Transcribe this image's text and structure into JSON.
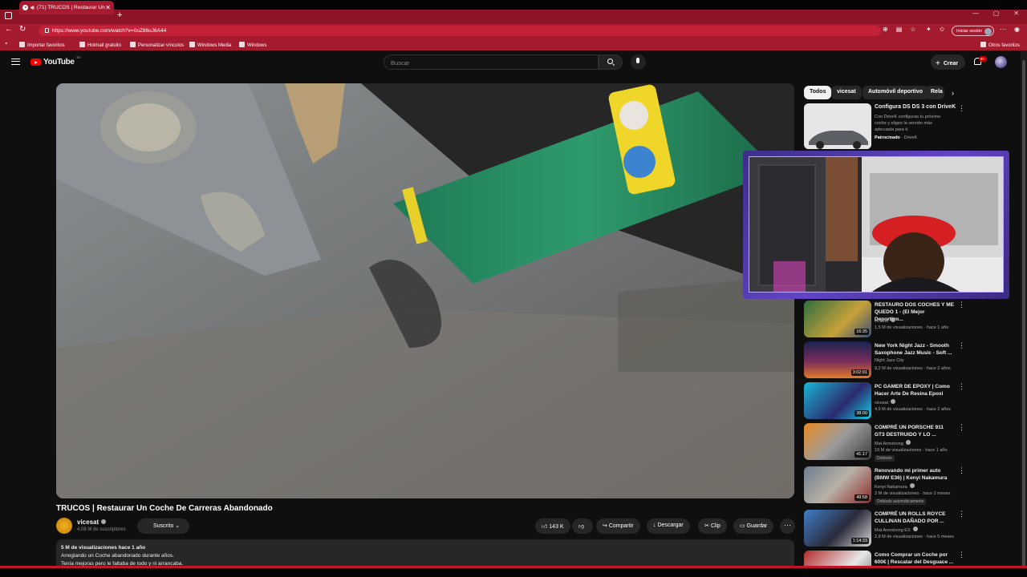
{
  "browser": {
    "tab_title": "(71) TRUCOS | Restaurar Un",
    "url": "https://www.youtube.com/watch?v=0oZ86uJ6A44",
    "sign_in": "Iniciar sesión",
    "favorites": [
      "Importar favoritos",
      "Hotmail gratuito",
      "Personalizar vínculos",
      "Windows Media",
      "Windows"
    ],
    "other_favorites": "Otros favoritos"
  },
  "header": {
    "logo_text": "YouTube",
    "logo_region": "ES",
    "search_placeholder": "Buscar",
    "create_label": "Crear",
    "notification_count": "9+"
  },
  "video": {
    "title": "TRUCOS | Restaurar Un Coche De Carreras Abandonado",
    "channel": "vicesat",
    "subscribers": "4,08 M de suscriptores",
    "subscribed_label": "Suscrito",
    "likes": "143 K",
    "share_label": "Compartir",
    "download_label": "Descargar",
    "clip_label": "Clip",
    "save_label": "Guardar",
    "description_meta": "5 M de visualizaciones  hace 1 año",
    "description_line1": "Arreglando un Coche abandonado durante años.",
    "description_line2": "Tenía mejoras pero le faltaba de todo y ni arrancaba."
  },
  "sidebar": {
    "chips": [
      "Todos",
      "vicesat",
      "Automóvil deportivo",
      "Rela"
    ],
    "ad": {
      "title": "Configura DS DS 3 con DriveK",
      "description": "Con DriveK configuras tu próximo coche y eliges la versión más adecuada para ti.",
      "sponsored": "Patrocinado",
      "advertiser": "DriveK"
    },
    "recommendations": [
      {
        "title": "RESTAURO DOS COCHES Y ME QUEDO 1 - (El Mejor Deportivo...",
        "channel": "vicesat",
        "meta": "1,5 M de visualizaciones · hace 1 año",
        "duration": "16:35",
        "tag": ""
      },
      {
        "title": "New York Night Jazz - Smooth Saxophone Jazz Music - Soft ...",
        "channel": "Night Jazz City",
        "meta": "9,2 M de visualizaciones · hace 2 años",
        "duration": "3:02:01",
        "tag": ""
      },
      {
        "title": "PC GAMER DE EPOXY | Como Hacer Arte De Resina Epoxi",
        "channel": "vicesat",
        "meta": "4,5 M de visualizaciones · hace 2 años",
        "duration": "38:00",
        "tag": ""
      },
      {
        "title": "COMPRÉ UN PORSCHE 911 GT3 DESTRUIDO Y LO ...",
        "channel": "Mat Armstrong",
        "meta": "19 M de visualizaciones · hace 1 año",
        "duration": "41:17",
        "tag": "Doblado"
      },
      {
        "title": "Renovando mi primer auto (BMW E36) | Kenyi Nakamura",
        "channel": "Kenyi Nakamura",
        "meta": "3 M de visualizaciones · hace 2 meses",
        "duration": "49:58",
        "tag": "Doblado automáticamente"
      },
      {
        "title": "COMPRÉ UN ROLLS ROYCE CULLINAN DAÑADO POR ...",
        "channel": "Mat Armstrong ES",
        "meta": "2,8 M de visualizaciones · hace 5 meses",
        "duration": "1:14:33",
        "tag": ""
      },
      {
        "title": "Como Comprar un Coche por 600€ | Rescatar del Desguace ...",
        "channel": "",
        "meta": "",
        "duration": "",
        "tag": ""
      }
    ]
  },
  "colors": {
    "browser_accent": "#a41a2e",
    "youtube_red": "#ff0000",
    "background": "#0f0f0f"
  }
}
